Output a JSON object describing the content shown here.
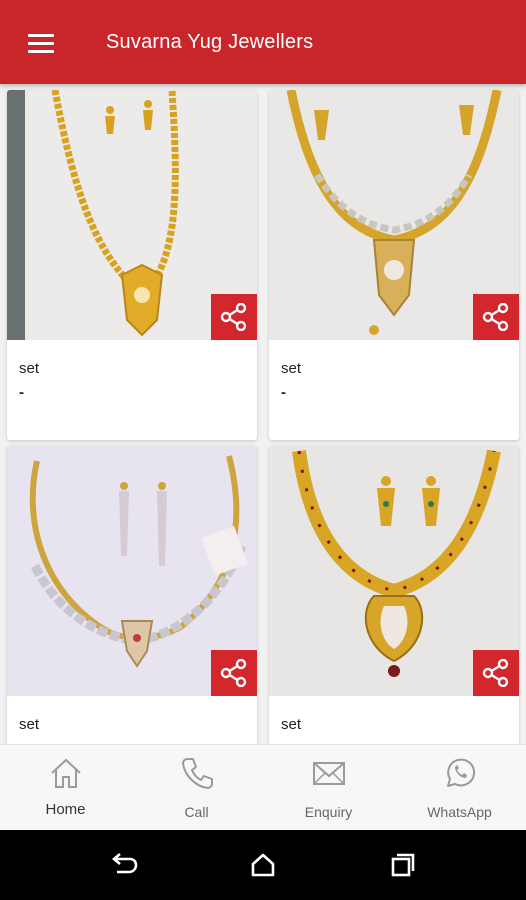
{
  "app": {
    "title": "Suvarna Yug Jewellers"
  },
  "products": [
    {
      "name": "set",
      "price": "-",
      "image": "long-gold-necklace-with-earrings"
    },
    {
      "name": "set",
      "price": "-",
      "image": "gold-necklace-with-pendant-and-earrings"
    },
    {
      "name": "set",
      "price": "-",
      "image": "diamond-stone-necklace-with-drop-earrings"
    },
    {
      "name": "set",
      "price": "-",
      "image": "kundan-gold-necklace-with-earrings"
    }
  ],
  "share_icon": "share-icon",
  "bottom_nav": {
    "items": [
      {
        "label": "Home",
        "icon": "home-icon",
        "active": true
      },
      {
        "label": "Call",
        "icon": "phone-icon"
      },
      {
        "label": "Enquiry",
        "icon": "mail-icon"
      },
      {
        "label": "WhatsApp",
        "icon": "whatsapp-icon"
      }
    ]
  },
  "system_nav": [
    "back-icon",
    "home-circle-icon",
    "recents-icon"
  ],
  "colors": {
    "primary": "#c9262c",
    "share_button": "#d3262d",
    "background": "#f1f1f1"
  }
}
